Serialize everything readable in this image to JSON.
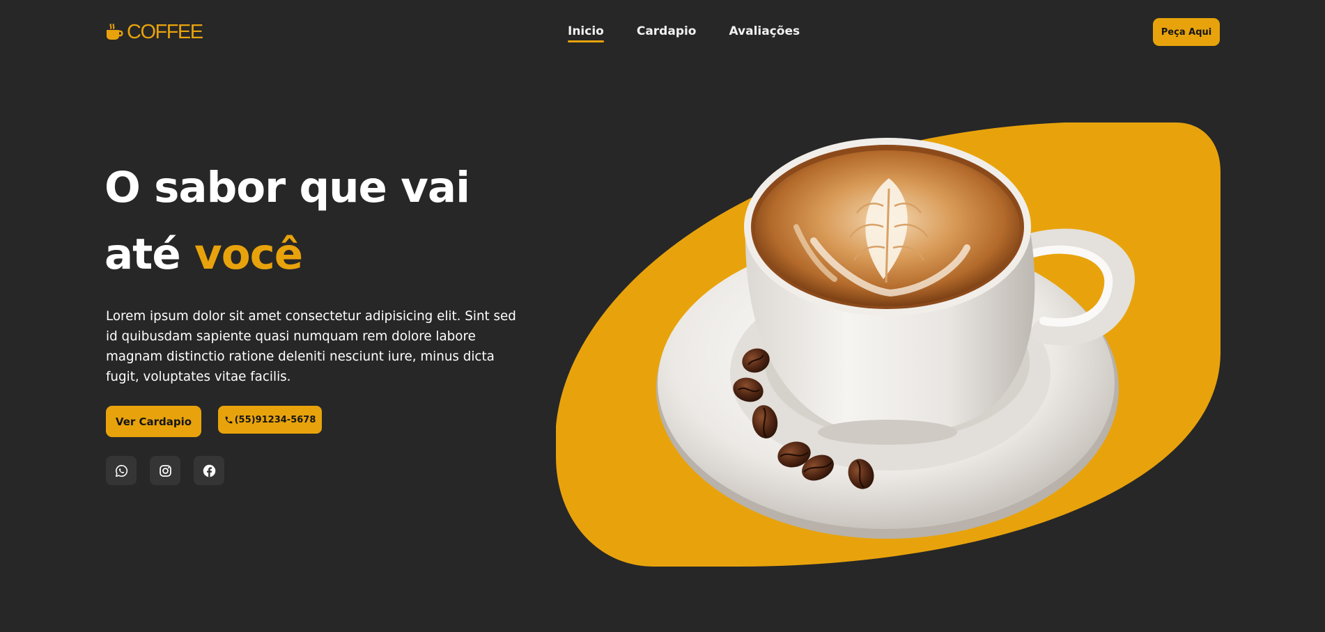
{
  "brand": {
    "name": "COFFEE",
    "accent_color": "#e8a30c",
    "background_color": "#272727",
    "icon": "coffee-cup-icon"
  },
  "nav": {
    "items": [
      {
        "label": "Inicio",
        "active": true
      },
      {
        "label": "Cardapio",
        "active": false
      },
      {
        "label": "Avaliações",
        "active": false
      }
    ],
    "cta_label": "Peça Aqui"
  },
  "hero": {
    "title_line1": "O sabor que vai",
    "title_line2_prefix": "até ",
    "title_line2_accent": "você",
    "description": "Lorem ipsum dolor sit amet consectetur adipisicing elit. Sint sed id quibusdam sapiente quasi numquam rem dolore labore magnam distinctio ratione deleniti nesciunt iure, minus dicta fugit, voluptates vitae facilis.",
    "menu_button_label": "Ver Cardapio",
    "phone_button_label": "(55)91234-5678",
    "phone_icon": "phone-icon",
    "socials": [
      {
        "icon": "whatsapp-icon"
      },
      {
        "icon": "instagram-icon"
      },
      {
        "icon": "facebook-icon"
      }
    ],
    "image": "latte-cup-with-coffee-beans"
  }
}
